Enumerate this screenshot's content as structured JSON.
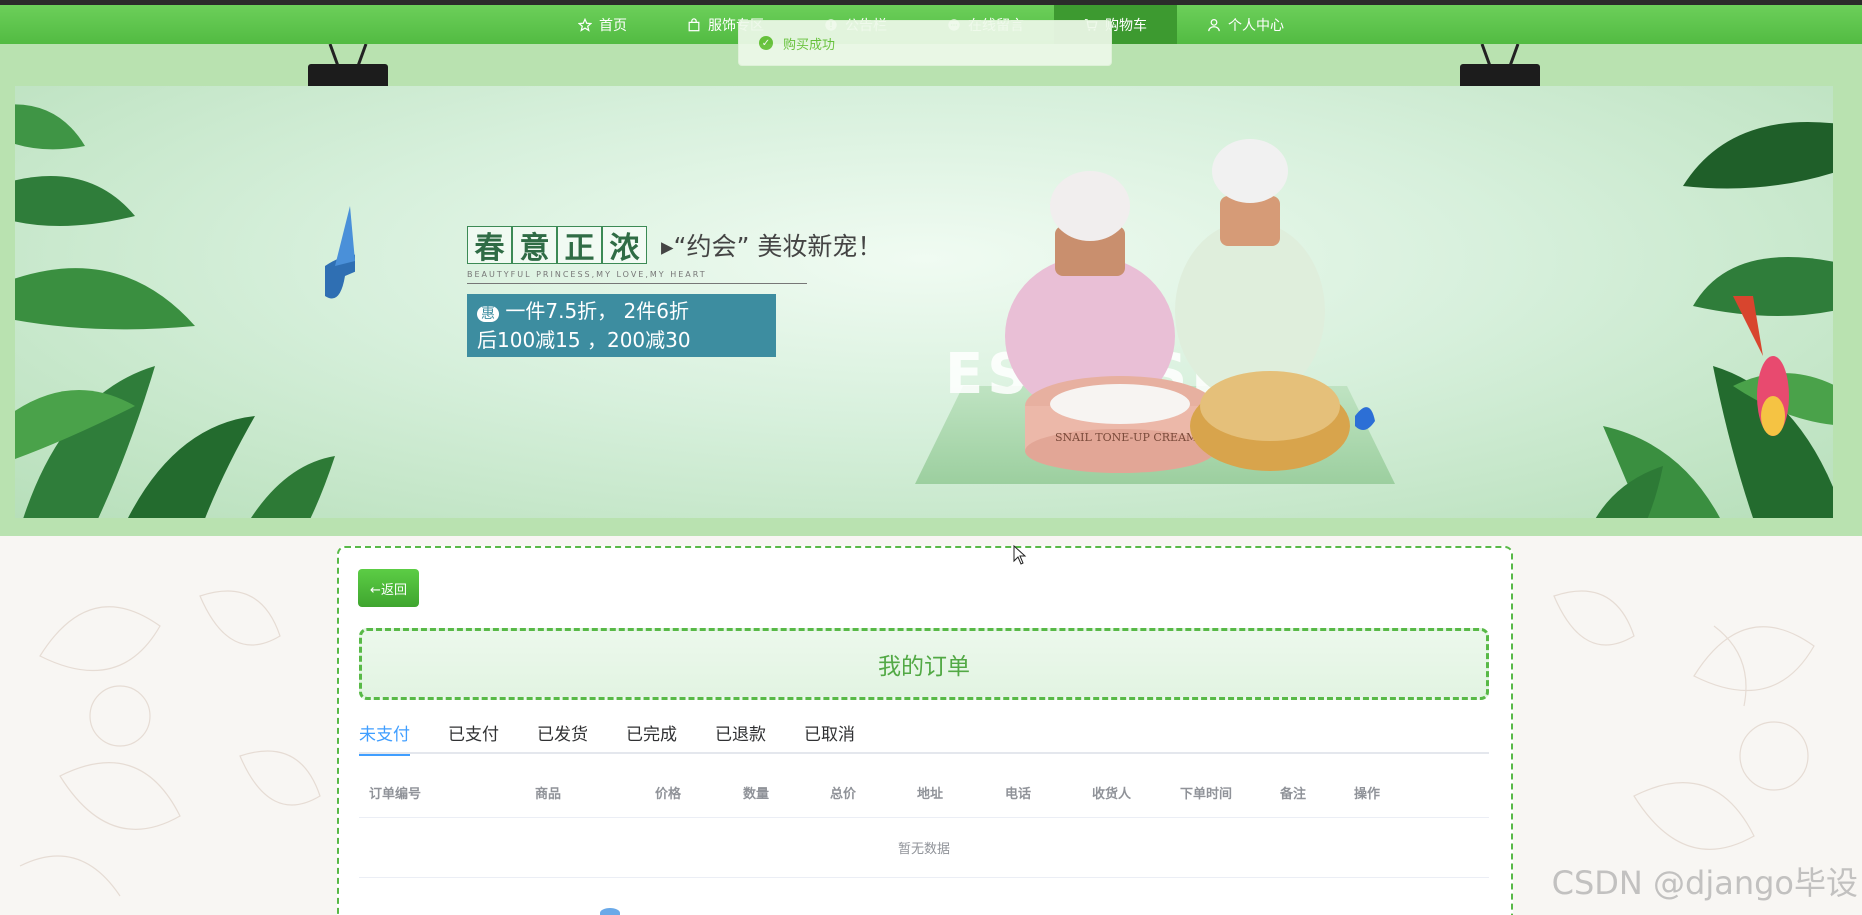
{
  "nav": {
    "items": [
      {
        "label": "首页",
        "icon": "star-icon"
      },
      {
        "label": "服饰专区",
        "icon": "bag-icon"
      },
      {
        "label": "公告栏",
        "icon": "info-icon"
      },
      {
        "label": "在线留言",
        "icon": "message-icon"
      },
      {
        "label": "购物车",
        "icon": "cart-icon",
        "active": true
      },
      {
        "label": "个人中心",
        "icon": "user-icon"
      }
    ]
  },
  "toast": {
    "message": "购买成功",
    "type": "success"
  },
  "banner": {
    "title_chars": [
      "春",
      "意",
      "正",
      "浓"
    ],
    "subtitle": "▸“约会” 美妆新宠！",
    "small": "BEAUTYFUL PRINCESS,MY LOVE,MY HEART",
    "deal_badge": "惠",
    "deal_line1": "一件7.5折， 2件6折",
    "deal_line2": "后100减15 ，200减30",
    "brand_text": "ESE   USE",
    "product_label": "SNAIL TONE-UP CREAM",
    "active_slide": 2,
    "slide_count": 3
  },
  "page": {
    "back_label": "←返回",
    "title": "我的订单"
  },
  "tabs": [
    {
      "label": "未支付",
      "active": true
    },
    {
      "label": "已支付"
    },
    {
      "label": "已发货"
    },
    {
      "label": "已完成"
    },
    {
      "label": "已退款"
    },
    {
      "label": "已取消"
    }
  ],
  "table": {
    "columns": [
      "订单编号",
      "商品",
      "价格",
      "数量",
      "总价",
      "地址",
      "电话",
      "收货人",
      "下单时间",
      "备注",
      "操作"
    ],
    "empty_text": "暂无数据"
  },
  "watermark": "CSDN @django毕设",
  "colors": {
    "nav_green": "#52bb42",
    "nav_active": "#3d9a30",
    "accent_blue": "#409eff",
    "success": "#67c23a"
  }
}
